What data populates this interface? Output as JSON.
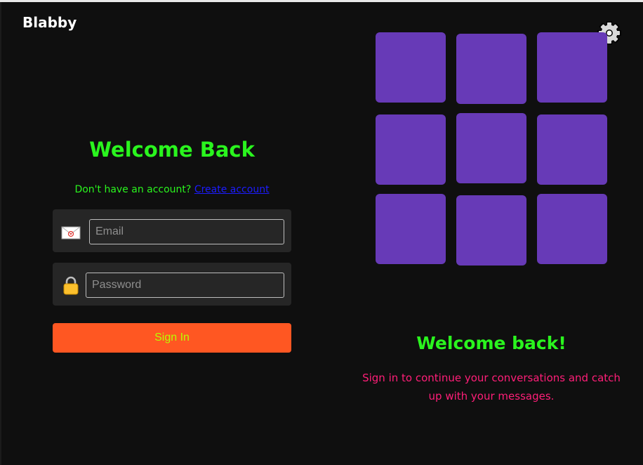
{
  "app": {
    "brand": "Blabby"
  },
  "header": {
    "settings_icon": "gear-icon"
  },
  "login": {
    "title": "Welcome Back",
    "prompt": "Don't have an account?",
    "create_link": "Create account",
    "email": {
      "icon": "envelope-icon",
      "placeholder": "Email",
      "value": ""
    },
    "password": {
      "icon": "lock-icon",
      "placeholder": "Password",
      "value": ""
    },
    "submit_label": "Sign In"
  },
  "hero": {
    "tile_color": "#673ab7",
    "tile_count": 9,
    "title": "Welcome back!",
    "subtitle": "Sign in to continue your conversations and catch up with your messages."
  },
  "colors": {
    "background": "#0f0f0f",
    "accent_green": "#2af51e",
    "accent_pink": "#ff1e78",
    "button_orange": "#ff5722",
    "button_text": "#b8ff00",
    "link_blue": "#1c1cff"
  }
}
